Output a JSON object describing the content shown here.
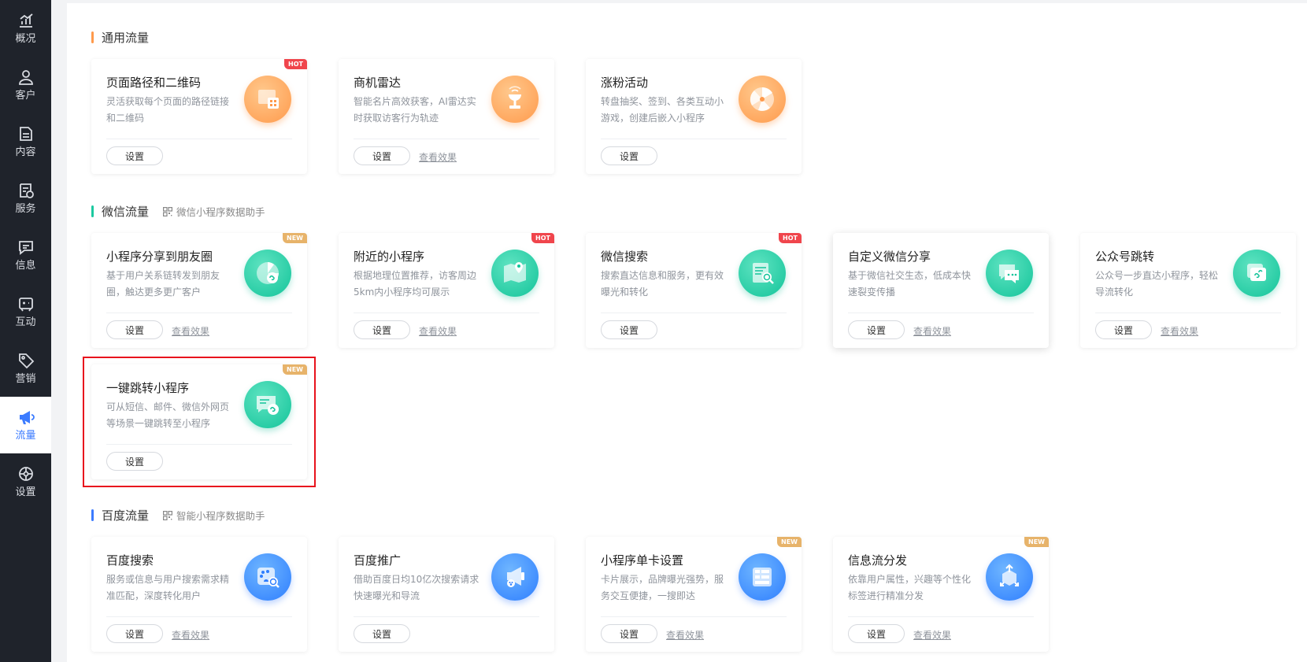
{
  "sidebar": {
    "items": [
      {
        "label": "概况",
        "icon": "chart-icon"
      },
      {
        "label": "客户",
        "icon": "user-icon"
      },
      {
        "label": "内容",
        "icon": "document-icon"
      },
      {
        "label": "服务",
        "icon": "service-icon"
      },
      {
        "label": "信息",
        "icon": "message-icon"
      },
      {
        "label": "互动",
        "icon": "interact-icon"
      },
      {
        "label": "营销",
        "icon": "tag-icon"
      },
      {
        "label": "流量",
        "icon": "megaphone-icon"
      },
      {
        "label": "设置",
        "icon": "settings-icon"
      }
    ],
    "active": "流量"
  },
  "sections": {
    "general": {
      "title": "通用流量"
    },
    "wechat": {
      "title": "微信流量",
      "helper": "微信小程序数据助手"
    },
    "baidu": {
      "title": "百度流量",
      "helper": "智能小程序数据助手"
    }
  },
  "common": {
    "set_label": "设置",
    "view_label": "查看效果",
    "hot": "HOT",
    "new": "NEW"
  },
  "cards": {
    "page_path": {
      "title": "页面路径和二维码",
      "desc": "灵活获取每个页面的路径链接和二维码",
      "icon": "qrcode-page-icon"
    },
    "radar": {
      "title": "商机雷达",
      "desc": "智能名片高效获客，AI雷达实时获取访客行为轨迹",
      "icon": "radar-icon"
    },
    "fans": {
      "title": "涨粉活动",
      "desc": "转盘抽奖、签到、各类互动小游戏，创建后嵌入小程序",
      "icon": "wheel-icon"
    },
    "moments": {
      "title": "小程序分享到朋友圈",
      "desc": "基于用户关系链转发到朋友圈，触达更多更广客户",
      "icon": "moments-share-icon"
    },
    "nearby": {
      "title": "附近的小程序",
      "desc": "根据地理位置推荐，访客周边5km内小程序均可展示",
      "icon": "map-pin-icon"
    },
    "wx_search": {
      "title": "微信搜索",
      "desc": "搜索直达信息和服务，更有效曝光和转化",
      "icon": "search-doc-icon"
    },
    "custom_share": {
      "title": "自定义微信分享",
      "desc": "基于微信社交生态，低成本快速裂变传播",
      "icon": "wechat-icon"
    },
    "official": {
      "title": "公众号跳转",
      "desc": "公众号一步直达小程序，轻松导流转化",
      "icon": "official-account-icon"
    },
    "one_click": {
      "title": "一键跳转小程序",
      "desc": "可从短信、邮件、微信外网页等场景一键跳转至小程序",
      "icon": "link-message-icon"
    },
    "bd_search": {
      "title": "百度搜索",
      "desc": "服务或信息与用户搜索需求精准匹配，深度转化用户",
      "icon": "baidu-search-icon"
    },
    "bd_promo": {
      "title": "百度推广",
      "desc": "借助百度日均10亿次搜索请求快速曝光和导流",
      "icon": "baidu-megaphone-icon"
    },
    "single_card": {
      "title": "小程序单卡设置",
      "desc": "卡片展示，品牌曝光强势，服务交互便捷，一搜即达",
      "icon": "card-list-icon"
    },
    "feed": {
      "title": "信息流分发",
      "desc": "依靠用户属性，兴趣等个性化标签进行精准分发",
      "icon": "distribute-icon"
    }
  }
}
